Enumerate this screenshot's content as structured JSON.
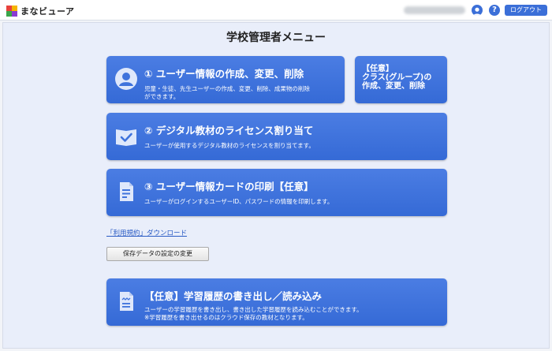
{
  "header": {
    "app_name": "まなビューア",
    "logout_label": "ログアウト",
    "help_label": "?"
  },
  "page": {
    "title": "学校管理者メニュー"
  },
  "cards": [
    {
      "title": "① ユーザー情報の作成、変更、削除",
      "desc": [
        "児童・生徒、先生ユーザーの作成、変更、削除、成果物の削除",
        "ができます。"
      ],
      "icon": "user-icon"
    },
    {
      "title": "【任意】",
      "lines": [
        "クラス(グループ)の",
        "作成、変更、削除"
      ]
    },
    {
      "title": "② デジタル教材のライセンス割り当て",
      "desc": [
        "ユーザーが使用するデジタル教材のライセンスを割り当てます。"
      ],
      "icon": "book-check-icon"
    },
    {
      "title": "③ ユーザー情報カードの印刷【任意】",
      "desc": [
        "ユーザーがログインするユーザーID、パスワードの情報を印刷します。"
      ],
      "icon": "document-icon"
    },
    {
      "title": "【任意】学習履歴の書き出し／読み込み",
      "desc": [
        "ユーザーの学習履歴を書き出し、書き出した学習履歴を読み込むことができます。",
        "※学習履歴を書き出せるのはクラウド保存の教材となります。"
      ],
      "icon": "history-file-icon"
    }
  ],
  "links": {
    "terms": "「利用規約」ダウンロード"
  },
  "buttons": {
    "save_settings": "保存データの設定の変更"
  },
  "colors": {
    "accent": "#3b6fd8",
    "card": "#3f73dc",
    "background": "#e9eefa"
  }
}
